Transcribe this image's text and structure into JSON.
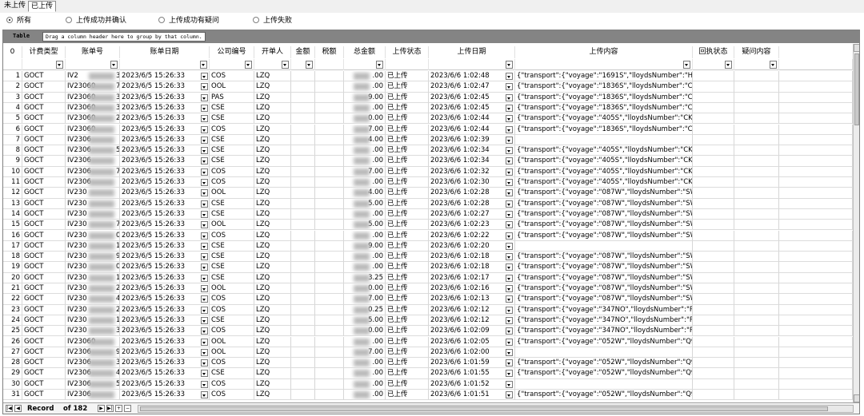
{
  "tabs": [
    {
      "label": "未上传",
      "active": false
    },
    {
      "label": "已上传",
      "active": true
    }
  ],
  "filters": [
    {
      "label": "所有",
      "checked": true
    },
    {
      "label": "上传成功并确认",
      "checked": false
    },
    {
      "label": "上传成功有疑问",
      "checked": false
    },
    {
      "label": "上传失败",
      "checked": false
    }
  ],
  "grid": {
    "group_label": "Table",
    "group_hint": "Drag a column header here to group by that column.",
    "columns": [
      "0",
      "计费类型",
      "账单号",
      "账单日期",
      "公司编号",
      "开单人",
      "金额",
      "税额",
      "总金额",
      "上传状态",
      "上传日期",
      "上传内容",
      "回执状态",
      "疑问内容"
    ],
    "rows": [
      {
        "n": "1",
        "type": "GOCT",
        "bill": "IV2",
        "bill_end": "3",
        "date": "2023/6/5 15:26:33",
        "company": "COS",
        "user": "LZQ",
        "total": ".00",
        "status": "已上传",
        "upload_date": "2023/6/6 1:02:48",
        "content": "{\"transport\":{\"voyage\":\"1691S\",\"lloydsNumber\":\"HNG\""
      },
      {
        "n": "2",
        "type": "GOCT",
        "bill": "IV23060",
        "bill_end": "7",
        "date": "2023/6/5 15:26:33",
        "company": "OOL",
        "user": "LZQ",
        "total": ".00",
        "status": "已上传",
        "upload_date": "2023/6/6 1:02:47",
        "content": "{\"transport\":{\"voyage\":\"1836S\",\"lloydsNumber\":\"CKD\""
      },
      {
        "n": "3",
        "type": "GOCT",
        "bill": "IV23060",
        "bill_end": "3",
        "date": "2023/6/5 15:26:33",
        "company": "PAS",
        "user": "LZQ",
        "total": "9.00",
        "status": "已上传",
        "upload_date": "2023/6/6 1:02:45",
        "content": "{\"transport\":{\"voyage\":\"1836S\",\"lloydsNumber\":\"CKD\""
      },
      {
        "n": "4",
        "type": "GOCT",
        "bill": "IV23060",
        "bill_end": "3",
        "date": "2023/6/5 15:26:33",
        "company": "CSE",
        "user": "LZQ",
        "total": ".00",
        "status": "已上传",
        "upload_date": "2023/6/6 1:02:45",
        "content": "{\"transport\":{\"voyage\":\"1836S\",\"lloydsNumber\":\"CKD\""
      },
      {
        "n": "5",
        "type": "GOCT",
        "bill": "IV23060",
        "bill_end": "2",
        "date": "2023/6/5 15:26:33",
        "company": "CSE",
        "user": "LZQ",
        "total": "0.00",
        "status": "已上传",
        "upload_date": "2023/6/6 1:02:44",
        "content": "{\"transport\":{\"voyage\":\"405S\",\"lloydsNumber\":\"CKF\",\""
      },
      {
        "n": "6",
        "type": "GOCT",
        "bill": "IV23060",
        "bill_end": "",
        "date": "2023/6/5 15:26:33",
        "company": "COS",
        "user": "LZQ",
        "total": "7.00",
        "status": "已上传",
        "upload_date": "2023/6/6 1:02:44",
        "content": "{\"transport\":{\"voyage\":\"1836S\",\"lloydsNumber\":\"CKD\""
      },
      {
        "n": "7",
        "type": "GOCT",
        "bill": "IV2306",
        "bill_end": "",
        "date": "2023/6/5 15:26:33",
        "company": "CSE",
        "user": "LZQ",
        "total": "4.00",
        "status": "已上传",
        "upload_date": "2023/6/6 1:02:39",
        "content": ""
      },
      {
        "n": "8",
        "type": "GOCT",
        "bill": "IV2306",
        "bill_end": "5",
        "date": "2023/6/5 15:26:33",
        "company": "CSE",
        "user": "LZQ",
        "total": ".00",
        "status": "已上传",
        "upload_date": "2023/6/6 1:02:34",
        "content": "{\"transport\":{\"voyage\":\"405S\",\"lloydsNumber\":\"CKF\",\""
      },
      {
        "n": "9",
        "type": "GOCT",
        "bill": "IV2306",
        "bill_end": "",
        "date": "2023/6/5 15:26:33",
        "company": "CSE",
        "user": "LZQ",
        "total": ".00",
        "status": "已上传",
        "upload_date": "2023/6/6 1:02:34",
        "content": "{\"transport\":{\"voyage\":\"405S\",\"lloydsNumber\":\"CKF\",\""
      },
      {
        "n": "10",
        "type": "GOCT",
        "bill": "IV2306",
        "bill_end": "7",
        "date": "2023/6/5 15:26:33",
        "company": "COS",
        "user": "LZQ",
        "total": "7.00",
        "status": "已上传",
        "upload_date": "2023/6/6 1:02:32",
        "content": "{\"transport\":{\"voyage\":\"405S\",\"lloydsNumber\":\"CKF\",\""
      },
      {
        "n": "11",
        "type": "GOCT",
        "bill": "IV2306",
        "bill_end": "",
        "date": "2023/6/5 15:26:33",
        "company": "COS",
        "user": "LZQ",
        "total": ".00",
        "status": "已上传",
        "upload_date": "2023/6/6 1:02:30",
        "content": "{\"transport\":{\"voyage\":\"405S\",\"lloydsNumber\":\"CKF\",\""
      },
      {
        "n": "12",
        "type": "GOCT",
        "bill": "IV230",
        "bill_end": "",
        "date": "2023/6/5 15:26:33",
        "company": "OOL",
        "user": "LZQ",
        "total": "4.00",
        "status": "已上传",
        "upload_date": "2023/6/6 1:02:28",
        "content": "{\"transport\":{\"voyage\":\"087W\",\"lloydsNumber\":\"SWP\""
      },
      {
        "n": "13",
        "type": "GOCT",
        "bill": "IV230",
        "bill_end": "",
        "date": "2023/6/5 15:26:33",
        "company": "CSE",
        "user": "LZQ",
        "total": "5.00",
        "status": "已上传",
        "upload_date": "2023/6/6 1:02:28",
        "content": "{\"transport\":{\"voyage\":\"087W\",\"lloydsNumber\":\"SWP\""
      },
      {
        "n": "14",
        "type": "GOCT",
        "bill": "IV230",
        "bill_end": "",
        "date": "2023/6/5 15:26:33",
        "company": "CSE",
        "user": "LZQ",
        "total": ".00",
        "status": "已上传",
        "upload_date": "2023/6/6 1:02:27",
        "content": "{\"transport\":{\"voyage\":\"087W\",\"lloydsNumber\":\"SWP\""
      },
      {
        "n": "15",
        "type": "GOCT",
        "bill": "IV230",
        "bill_end": "7",
        "date": "2023/6/5 15:26:33",
        "company": "OOL",
        "user": "LZQ",
        "total": "5.00",
        "status": "已上传",
        "upload_date": "2023/6/6 1:02:23",
        "content": "{\"transport\":{\"voyage\":\"087W\",\"lloydsNumber\":\"SWP\""
      },
      {
        "n": "16",
        "type": "GOCT",
        "bill": "IV230",
        "bill_end": "0",
        "date": "2023/6/5 15:26:33",
        "company": "COS",
        "user": "LZQ",
        "total": ".00",
        "status": "已上传",
        "upload_date": "2023/6/6 1:02:22",
        "content": "{\"transport\":{\"voyage\":\"087W\",\"lloydsNumber\":\"SWP\""
      },
      {
        "n": "17",
        "type": "GOCT",
        "bill": "IV230",
        "bill_end": "1",
        "date": "2023/6/5 15:26:33",
        "company": "CSE",
        "user": "LZQ",
        "total": "9.00",
        "status": "已上传",
        "upload_date": "2023/6/6 1:02:20",
        "content": ""
      },
      {
        "n": "18",
        "type": "GOCT",
        "bill": "IV230",
        "bill_end": "9",
        "date": "2023/6/5 15:26:33",
        "company": "CSE",
        "user": "LZQ",
        "total": ".00",
        "status": "已上传",
        "upload_date": "2023/6/6 1:02:18",
        "content": "{\"transport\":{\"voyage\":\"087W\",\"lloydsNumber\":\"SWP\""
      },
      {
        "n": "19",
        "type": "GOCT",
        "bill": "IV230",
        "bill_end": "0",
        "date": "2023/6/5 15:26:33",
        "company": "CSE",
        "user": "LZQ",
        "total": ".00",
        "status": "已上传",
        "upload_date": "2023/6/6 1:02:18",
        "content": "{\"transport\":{\"voyage\":\"087W\",\"lloydsNumber\":\"SWP\""
      },
      {
        "n": "20",
        "type": "GOCT",
        "bill": "IV230",
        "bill_end": "1",
        "date": "2023/6/5 15:26:33",
        "company": "CSE",
        "user": "LZQ",
        "total": "3.25",
        "status": "已上传",
        "upload_date": "2023/6/6 1:02:17",
        "content": "{\"transport\":{\"voyage\":\"087W\",\"lloydsNumber\":\"SWP\""
      },
      {
        "n": "21",
        "type": "GOCT",
        "bill": "IV230",
        "bill_end": "2",
        "date": "2023/6/5 15:26:33",
        "company": "OOL",
        "user": "LZQ",
        "total": "0.00",
        "status": "已上传",
        "upload_date": "2023/6/6 1:02:16",
        "content": "{\"transport\":{\"voyage\":\"087W\",\"lloydsNumber\":\"SWP\""
      },
      {
        "n": "22",
        "type": "GOCT",
        "bill": "IV230",
        "bill_end": "4",
        "date": "2023/6/5 15:26:33",
        "company": "COS",
        "user": "LZQ",
        "total": "7.00",
        "status": "已上传",
        "upload_date": "2023/6/6 1:02:13",
        "content": "{\"transport\":{\"voyage\":\"087W\",\"lloydsNumber\":\"SWP\""
      },
      {
        "n": "23",
        "type": "GOCT",
        "bill": "IV230",
        "bill_end": "2",
        "date": "2023/6/5 15:26:33",
        "company": "COS",
        "user": "LZQ",
        "total": "0.25",
        "status": "已上传",
        "upload_date": "2023/6/6 1:02:12",
        "content": "{\"transport\":{\"voyage\":\"347NO\",\"lloydsNumber\":\"RLN"
      },
      {
        "n": "24",
        "type": "GOCT",
        "bill": "IV230",
        "bill_end": "1",
        "date": "2023/6/5 15:26:33",
        "company": "CSE",
        "user": "LZQ",
        "total": "5.00",
        "status": "已上传",
        "upload_date": "2023/6/6 1:02:12",
        "content": "{\"transport\":{\"voyage\":\"347NO\",\"lloydsNumber\":\"RLN"
      },
      {
        "n": "25",
        "type": "GOCT",
        "bill": "IV230",
        "bill_end": "3",
        "date": "2023/6/5 15:26:33",
        "company": "COS",
        "user": "LZQ",
        "total": "0.00",
        "status": "已上传",
        "upload_date": "2023/6/6 1:02:09",
        "content": "{\"transport\":{\"voyage\":\"347NO\",\"lloydsNumber\":\"RLN"
      },
      {
        "n": "26",
        "type": "GOCT",
        "bill": "IV23060",
        "bill_end": "",
        "date": "2023/6/5 15:26:33",
        "company": "OOL",
        "user": "LZQ",
        "total": ".00",
        "status": "已上传",
        "upload_date": "2023/6/6 1:02:05",
        "content": "{\"transport\":{\"voyage\":\"052W\",\"lloydsNumber\":\"Q9L\","
      },
      {
        "n": "27",
        "type": "GOCT",
        "bill": "IV2306",
        "bill_end": "9",
        "date": "2023/6/5 15:26:33",
        "company": "OOL",
        "user": "LZQ",
        "total": "7.00",
        "status": "已上传",
        "upload_date": "2023/6/6 1:02:00",
        "content": ""
      },
      {
        "n": "28",
        "type": "GOCT",
        "bill": "IV2306",
        "bill_end": "3",
        "date": "2023/6/5 15:26:33",
        "company": "COS",
        "user": "LZQ",
        "total": ".00",
        "status": "已上传",
        "upload_date": "2023/6/6 1:01:59",
        "content": "{\"transport\":{\"voyage\":\"052W\",\"lloydsNumber\":\"Q9L\","
      },
      {
        "n": "29",
        "type": "GOCT",
        "bill": "IV2306",
        "bill_end": "4",
        "date": "2023/6/5 15:26:33",
        "company": "CSE",
        "user": "LZQ",
        "total": ".00",
        "status": "已上传",
        "upload_date": "2023/6/6 1:01:55",
        "content": "{\"transport\":{\"voyage\":\"052W\",\"lloydsNumber\":\"Q9L\","
      },
      {
        "n": "30",
        "type": "GOCT",
        "bill": "IV2306",
        "bill_end": "5",
        "date": "2023/6/5 15:26:33",
        "company": "COS",
        "user": "LZQ",
        "total": ".00",
        "status": "已上传",
        "upload_date": "2023/6/6 1:01:52",
        "content": ""
      },
      {
        "n": "31",
        "type": "GOCT",
        "bill": "IV2306",
        "bill_end": "",
        "date": "2023/6/5 15:26:33",
        "company": "COS",
        "user": "LZQ",
        "total": ".00",
        "status": "已上传",
        "upload_date": "2023/6/6 1:01:51",
        "content": "{\"transport\":{\"voyage\":\"052W\",\"lloydsNumber\":\"Q9L\","
      }
    ]
  },
  "navigator": {
    "record_label": "Record",
    "of_label": "of 182"
  },
  "icons": {
    "dropdown": "chevron-down-icon",
    "radio": "radio-icon"
  },
  "colors": {
    "group_panel": "#848484",
    "grid_line": "#d6d6d6",
    "redaction": "#b9b9b9"
  }
}
